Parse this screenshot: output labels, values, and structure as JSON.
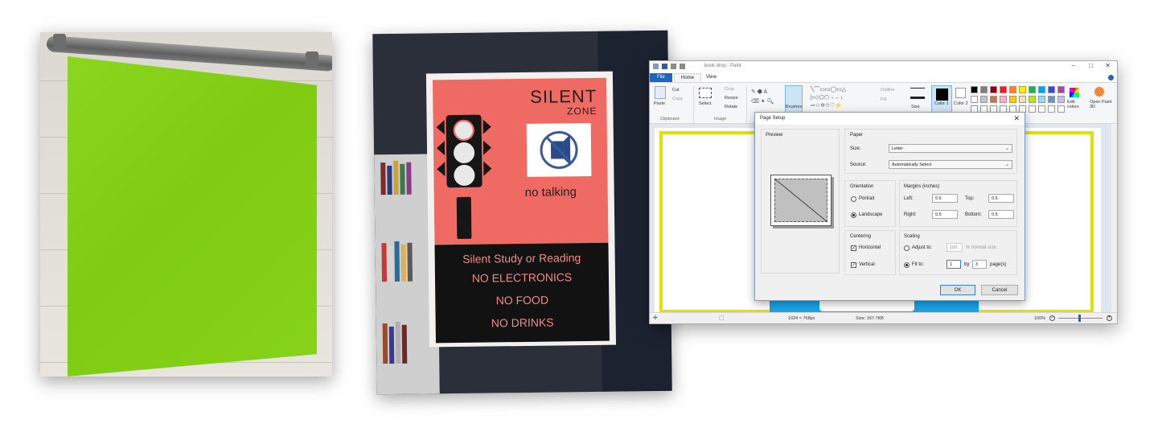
{
  "poster": {
    "silent": "SILENT",
    "zone": "ZONE",
    "no_talking": "no talking",
    "lines": [
      "Silent Study or Reading",
      "NO ELECTRONICS",
      "NO FOOD",
      "NO DRINKS"
    ]
  },
  "paint": {
    "title": "book drop - Paint",
    "tabs": [
      "File",
      "Home",
      "View"
    ],
    "ribbon": {
      "paste": "Paste",
      "cut": "Cut",
      "copy": "Copy",
      "clipboard": "Clipboard",
      "select": "Select",
      "crop": "Crop",
      "resize": "Resize",
      "rotate": "Rotate",
      "image": "Image",
      "brushes": "Brushes",
      "outline": "Outline",
      "fill": "Fill",
      "size": "Size",
      "color1": "Color 1",
      "color2": "Color 2",
      "edit_colors": "Edit colors",
      "open_paint3d": "Open Paint 3D"
    },
    "palette_colors": [
      "#000000",
      "#7f7f7f",
      "#880015",
      "#ed1c24",
      "#ff7f27",
      "#fff200",
      "#22b14c",
      "#00a2e8",
      "#3f48cc",
      "#a349a4",
      "#ffffff",
      "#c3c3c3",
      "#b97a57",
      "#ffaec9",
      "#ffc90e",
      "#efe4b0",
      "#b5e61d",
      "#99d9ea",
      "#7092be",
      "#c8bfe7"
    ],
    "status": {
      "dimensions": "1024 × 768px",
      "size": "Size: 167.7KB",
      "zoom": "100%"
    }
  },
  "dialog": {
    "title": "Page Setup",
    "preview_label": "Preview",
    "paper_label": "Paper",
    "size_label": "Size:",
    "size_value": "Letter",
    "source_label": "Source:",
    "source_value": "Automatically Select",
    "orientation_label": "Orientation",
    "portrait": "Portrait",
    "landscape": "Landscape",
    "margins_label": "Margins (inches)",
    "left_label": "Left:",
    "left_value": "0.5",
    "top_label": "Top:",
    "top_value": "0.5",
    "right_label": "Right:",
    "right_value": "0.5",
    "bottom_label": "Bottom:",
    "bottom_value": "0.5",
    "centering_label": "Centering",
    "horizontal": "Horizontal",
    "vertical": "Vertical",
    "scaling_label": "Scaling",
    "adjust_to": "Adjust to:",
    "adjust_value": "100",
    "normal_size": "% normal size",
    "fit_to": "Fit to:",
    "fit_value": "1",
    "by": "by",
    "by_value": "3",
    "pages": "page(s)",
    "ok": "OK",
    "cancel": "Cancel"
  }
}
